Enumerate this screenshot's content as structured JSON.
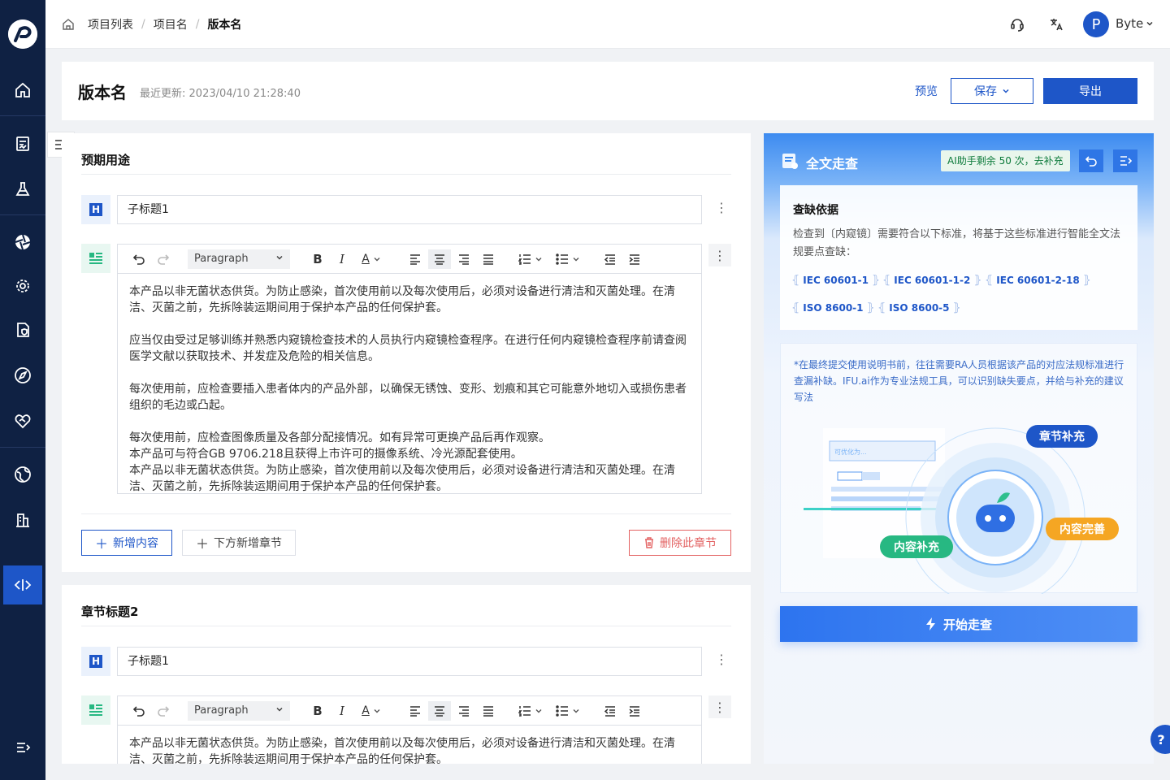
{
  "app": {
    "user_initial": "P",
    "user_name": "Byte"
  },
  "breadcrumb": {
    "items": [
      "项目列表",
      "项目名",
      "版本名"
    ]
  },
  "header": {
    "title": "版本名",
    "updated_label": "最近更新:",
    "updated_value": "2023/04/10 21:28:40",
    "preview_label": "预览",
    "save_label": "保存",
    "export_label": "导出"
  },
  "editor_toolbar": {
    "paragraph_select": "Paragraph"
  },
  "sections": [
    {
      "title": "预期用途",
      "subtitle": "子标题1",
      "paragraphs": [
        "本产品以非无菌状态供货。为防止感染，首次使用前以及每次使用后，必须对设备进行清洁和灭菌处理。在清洁、灭菌之前，先拆除装运期间用于保护本产品的任何保护套。",
        "应当仅由受过足够训练并熟悉内窥镜检查技术的人员执行内窥镜检查程序。在进行任何内窥镜检查程序前请查阅医学文献以获取技术、并发症及危险的相关信息。",
        "每次使用前，应检查要插入患者体内的产品外部，以确保无锈蚀、变形、划痕和其它可能意外地切入或损伤患者组织的毛边或凸起。",
        "每次使用前，应检查图像质量及各部分配接情况。如有异常可更换产品后再作观察。",
        "本产品可与符合GB 9706.218且获得上市许可的摄像系统、冷光源配套使用。",
        "本产品以非无菌状态供货。为防止感染，首次使用前以及每次使用后，必须对设备进行清洁和灭菌处理。在清洁、灭菌之前，先拆除装运期间用于保护本产品的任何保护套。"
      ],
      "add_content_label": "新增内容",
      "add_section_label": "下方新增章节",
      "delete_label": "删除此章节"
    },
    {
      "title": "章节标题2",
      "subtitle": "子标题1",
      "paragraphs": [
        "本产品以非无菌状态供货。为防止感染，首次使用前以及每次使用后，必须对设备进行清洁和灭菌处理。在清洁、灭菌之前，先拆除装运期间用于保护本产品的任何保护套。"
      ]
    }
  ],
  "panel": {
    "title": "全文走查",
    "ai_quota": "AI助手剩余 50 次，去补充",
    "basis_title": "查缺依据",
    "basis_desc": "检查到〔内窥镜〕需要符合以下标准，将基于这些标准进行智能全文法规要点查缺：",
    "standards": [
      "IEC 60601-1",
      "IEC 60601-1-2",
      "IEC 60601-2-18",
      "ISO 8600-1",
      "ISO 8600-5"
    ],
    "info_text": "*在最终提交使用说明书前，往往需要RA人员根据该产品的对应法规标准进行查漏补缺。IFU.ai作为专业法规工具，可以识别缺失要点，并给与补充的建议写法",
    "illus_input_text": "可优化为...",
    "tags": [
      "章节补充",
      "内容完善",
      "内容补充"
    ],
    "start_label": "开始走查"
  },
  "help_label": "?",
  "colors": {
    "primary": "#1e56c8",
    "sidebar": "#0f2143",
    "danger": "#e36262",
    "green_tag": "#27b882",
    "orange_tag": "#f5a623"
  }
}
